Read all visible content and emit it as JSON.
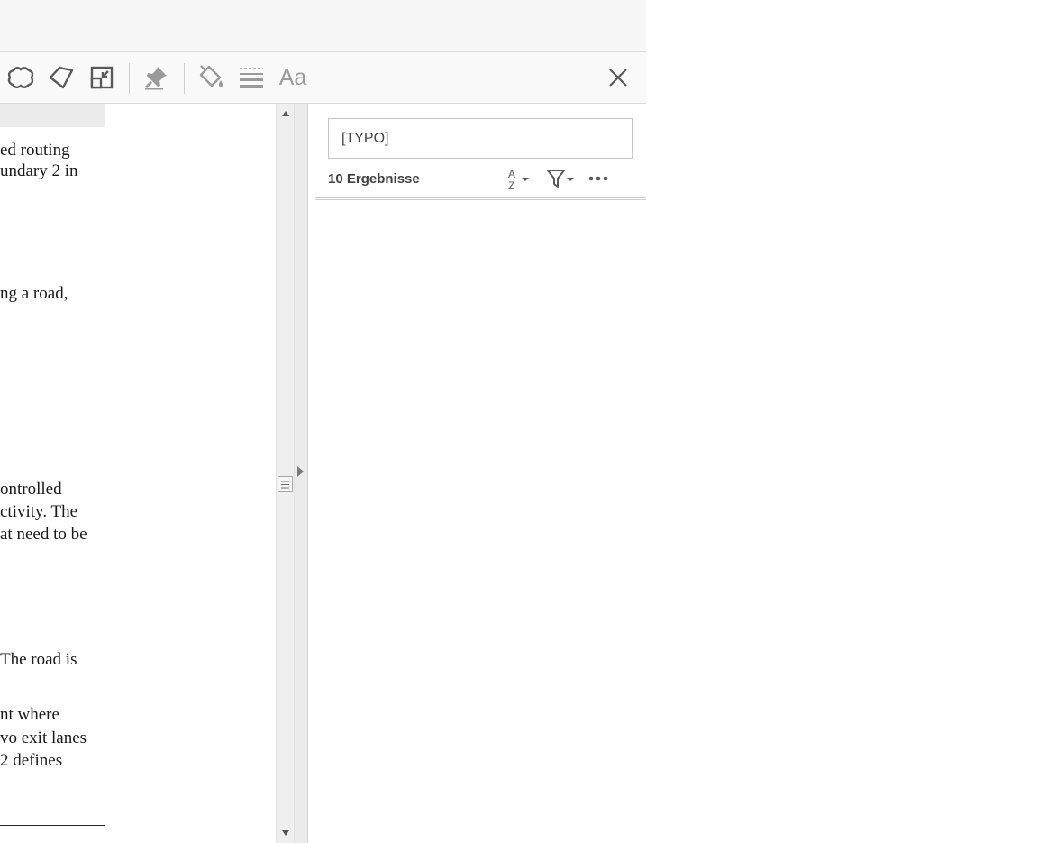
{
  "toolbar": {
    "icons": [
      "cloud-shape-icon",
      "polygon-icon",
      "resize-icon",
      "pin-icon",
      "paint-bucket-icon",
      "line-style-icon",
      "font-icon",
      "close-icon"
    ],
    "font_label": "Aa"
  },
  "document": {
    "lines": [
      "ed routing",
      "undary 2 in",
      "ng a road,",
      "ontrolled",
      "ctivity. The",
      "at need to be",
      "The road is",
      "nt where",
      "vo exit lanes",
      " 2 defines"
    ]
  },
  "search": {
    "value": "[TYPO]",
    "result_count": "10 Ergebnisse"
  },
  "colors": {
    "icon": "#5a5a5a",
    "icon_disabled": "#9a9a9a",
    "panel_bg": "#ffffff",
    "toolbar_bg": "#f9f9f9"
  }
}
